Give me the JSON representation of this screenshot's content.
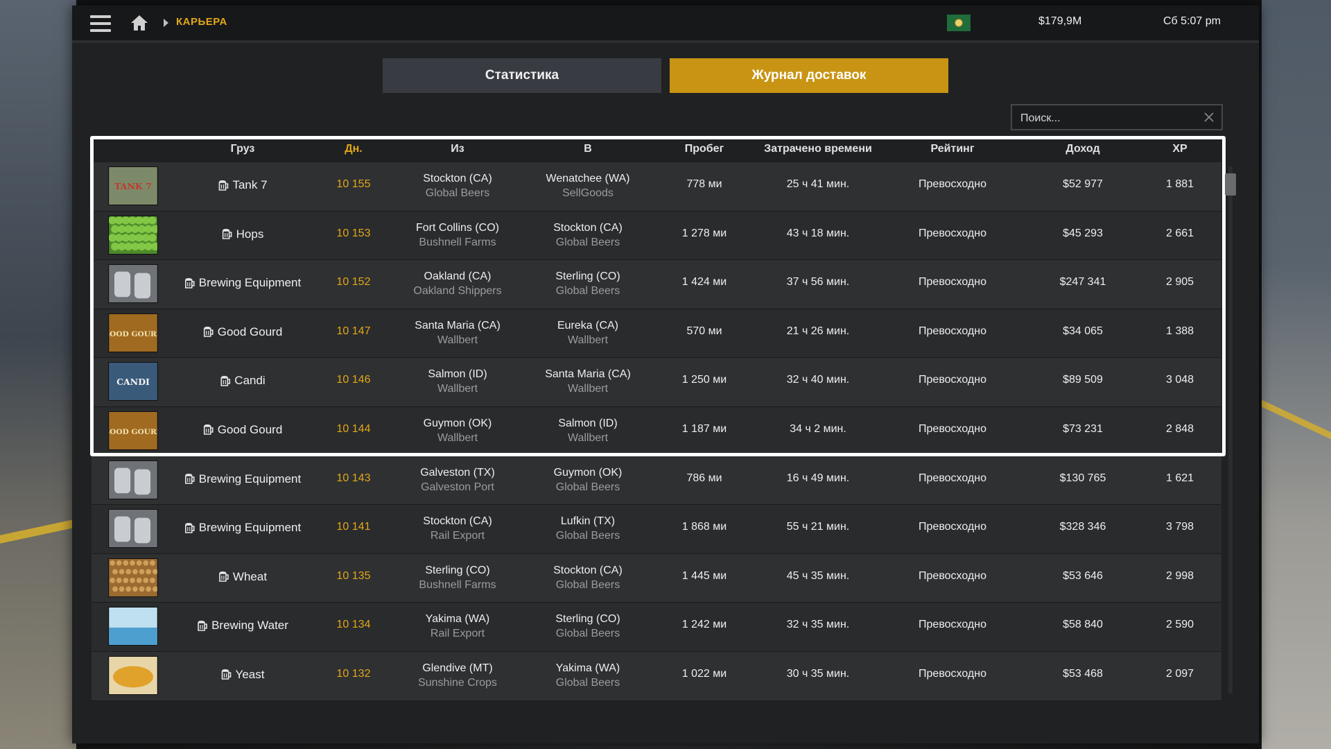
{
  "topbar": {
    "breadcrumb": "КАРЬЕРА",
    "money": "$179,9M",
    "clock": "Сб 5:07 pm"
  },
  "tabs": {
    "stats": "Статистика",
    "log": "Журнал доставок"
  },
  "search": {
    "placeholder": "Поиск..."
  },
  "table": {
    "headers": {
      "cargo": "Груз",
      "days": "Дн.",
      "from": "Из",
      "to": "В",
      "distance": "Пробег",
      "time": "Затрачено времени",
      "rating": "Рейтинг",
      "income": "Доход",
      "xp": "XP"
    },
    "rows": [
      {
        "cargo": "Tank 7",
        "days": "10 155",
        "from_city": "Stockton (CA)",
        "from_company": "Global Beers",
        "to_city": "Wenatchee (WA)",
        "to_company": "SellGoods",
        "distance": "778 ми",
        "time": "25 ч 41 мин.",
        "rating": "Превосходно",
        "income": "$52 977",
        "xp": "1 881",
        "thumb": "tank7"
      },
      {
        "cargo": "Hops",
        "days": "10 153",
        "from_city": "Fort Collins (CO)",
        "from_company": "Bushnell Farms",
        "to_city": "Stockton (CA)",
        "to_company": "Global Beers",
        "distance": "1 278 ми",
        "time": "43 ч 18 мин.",
        "rating": "Превосходно",
        "income": "$45 293",
        "xp": "2 661",
        "thumb": "hops"
      },
      {
        "cargo": "Brewing Equipment",
        "days": "10 152",
        "from_city": "Oakland (CA)",
        "from_company": "Oakland Shippers",
        "to_city": "Sterling (CO)",
        "to_company": "Global Beers",
        "distance": "1 424 ми",
        "time": "37 ч 56 мин.",
        "rating": "Превосходно",
        "income": "$247 341",
        "xp": "2 905",
        "thumb": "equipment"
      },
      {
        "cargo": "Good Gourd",
        "days": "10 147",
        "from_city": "Santa Maria (CA)",
        "from_company": "Wallbert",
        "to_city": "Eureka (CA)",
        "to_company": "Wallbert",
        "distance": "570 ми",
        "time": "21 ч 26 мин.",
        "rating": "Превосходно",
        "income": "$34 065",
        "xp": "1 388",
        "thumb": "gourd"
      },
      {
        "cargo": "Candi",
        "days": "10 146",
        "from_city": "Salmon (ID)",
        "from_company": "Wallbert",
        "to_city": "Santa Maria (CA)",
        "to_company": "Wallbert",
        "distance": "1 250 ми",
        "time": "32 ч 40 мин.",
        "rating": "Превосходно",
        "income": "$89 509",
        "xp": "3 048",
        "thumb": "candi"
      },
      {
        "cargo": "Good Gourd",
        "days": "10 144",
        "from_city": "Guymon (OK)",
        "from_company": "Wallbert",
        "to_city": "Salmon (ID)",
        "to_company": "Wallbert",
        "distance": "1 187 ми",
        "time": "34 ч 2 мин.",
        "rating": "Превосходно",
        "income": "$73 231",
        "xp": "2 848",
        "thumb": "gourd"
      },
      {
        "cargo": "Brewing Equipment",
        "days": "10 143",
        "from_city": "Galveston (TX)",
        "from_company": "Galveston Port",
        "to_city": "Guymon (OK)",
        "to_company": "Global Beers",
        "distance": "786 ми",
        "time": "16 ч 49 мин.",
        "rating": "Превосходно",
        "income": "$130 765",
        "xp": "1 621",
        "thumb": "equipment"
      },
      {
        "cargo": "Brewing Equipment",
        "days": "10 141",
        "from_city": "Stockton (CA)",
        "from_company": "Rail Export",
        "to_city": "Lufkin (TX)",
        "to_company": "Global Beers",
        "distance": "1 868 ми",
        "time": "55 ч 21 мин.",
        "rating": "Превосходно",
        "income": "$328 346",
        "xp": "3 798",
        "thumb": "equipment"
      },
      {
        "cargo": "Wheat",
        "days": "10 135",
        "from_city": "Sterling (CO)",
        "from_company": "Bushnell Farms",
        "to_city": "Stockton (CA)",
        "to_company": "Global Beers",
        "distance": "1 445 ми",
        "time": "45 ч 35 мин.",
        "rating": "Превосходно",
        "income": "$53 646",
        "xp": "2 998",
        "thumb": "wheat"
      },
      {
        "cargo": "Brewing Water",
        "days": "10 134",
        "from_city": "Yakima (WA)",
        "from_company": "Rail Export",
        "to_city": "Sterling (CO)",
        "to_company": "Global Beers",
        "distance": "1 242 ми",
        "time": "32 ч 35 мин.",
        "rating": "Превосходно",
        "income": "$58 840",
        "xp": "2 590",
        "thumb": "water"
      },
      {
        "cargo": "Yeast",
        "days": "10 132",
        "from_city": "Glendive (MT)",
        "from_company": "Sunshine Crops",
        "to_city": "Yakima (WA)",
        "to_company": "Global Beers",
        "distance": "1 022 ми",
        "time": "30 ч 35 мин.",
        "rating": "Превосходно",
        "income": "$53 468",
        "xp": "2 097",
        "thumb": "yeast"
      }
    ]
  },
  "thumbs": {
    "tank7": {
      "bg": "#7d8a6a",
      "fg": "#c23a2a",
      "label": "TANK 7"
    },
    "hops": {
      "bg": "#4d8a2a",
      "fg": "#8bd04a",
      "label": ""
    },
    "equipment": {
      "bg": "#6f7378",
      "fg": "#c9ccd0",
      "label": ""
    },
    "gourd": {
      "bg": "#a06a20",
      "fg": "#f2e2b0",
      "label": "GOOD GOURD"
    },
    "candi": {
      "bg": "#3a5a7a",
      "fg": "#f3f3f3",
      "label": "CANDI"
    },
    "wheat": {
      "bg": "#9a6a30",
      "fg": "#d8a964",
      "label": ""
    },
    "water": {
      "bg": "#bfe0f0",
      "fg": "#4d9fd0",
      "label": ""
    },
    "yeast": {
      "bg": "#e8d6a8",
      "fg": "#e0a22a",
      "label": ""
    }
  },
  "colors": {
    "accent": "#e2a818",
    "active_tab": "#c99414",
    "inactive_tab": "#383c42"
  }
}
